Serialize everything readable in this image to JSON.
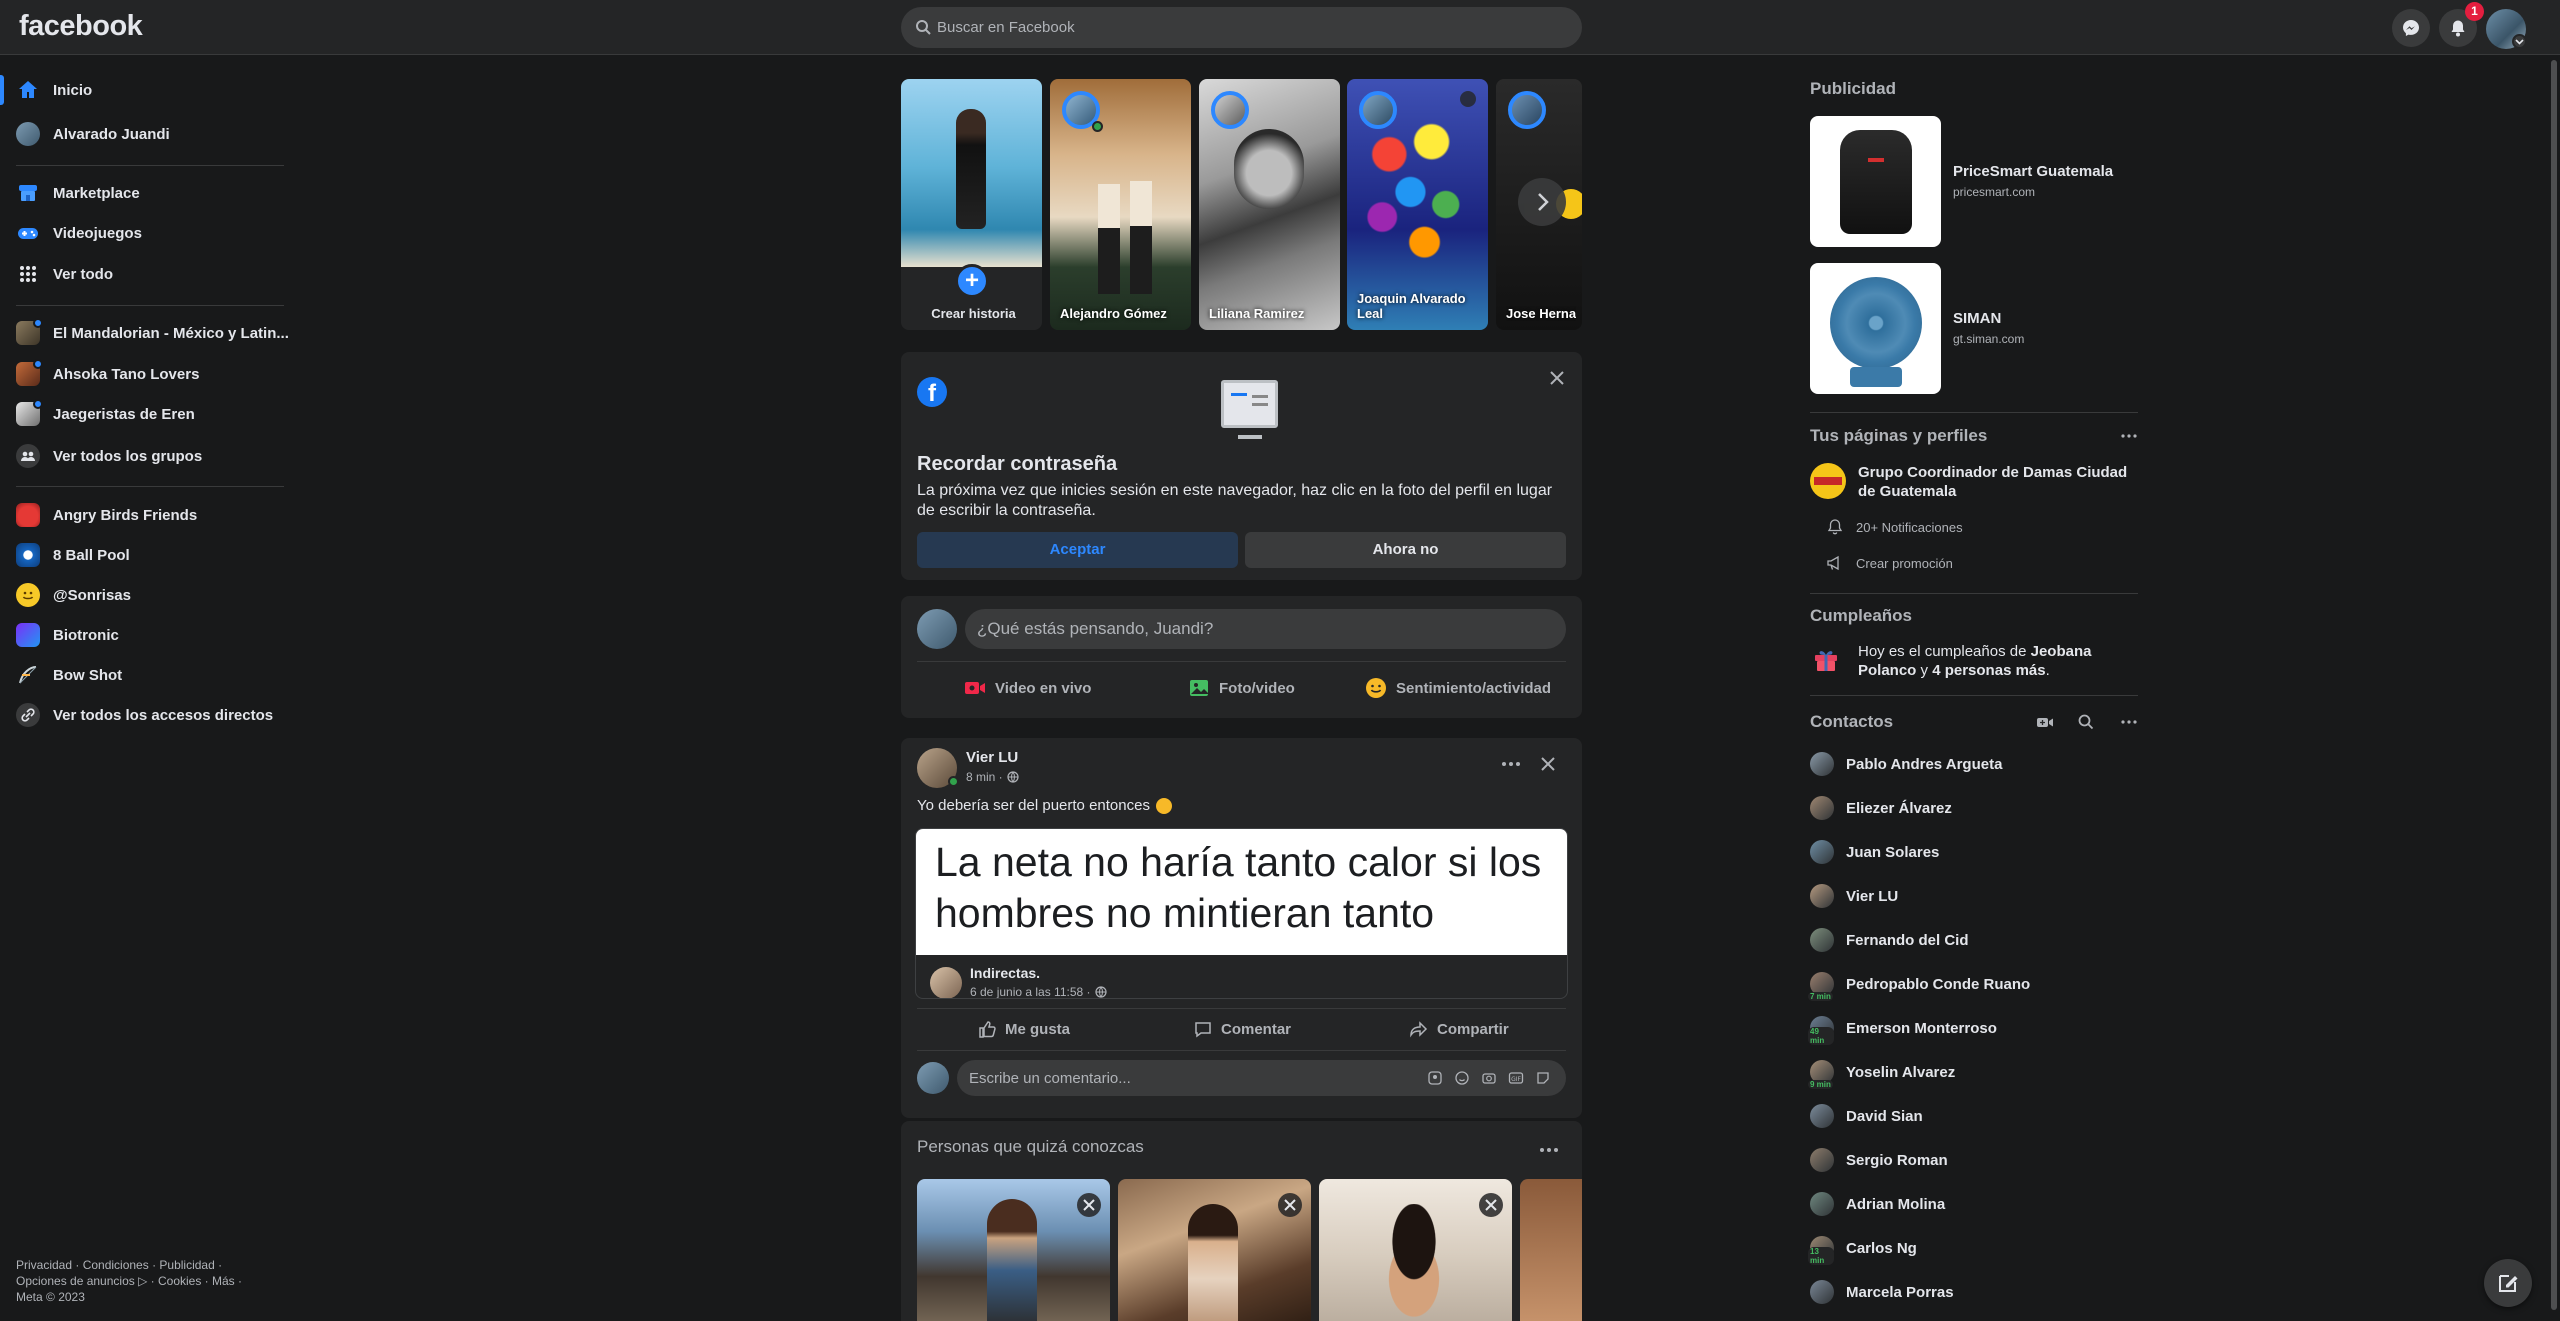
{
  "topbar": {
    "logo": "facebook",
    "search_placeholder": "Buscar en Facebook",
    "notification_count": "1"
  },
  "left_nav": {
    "main": [
      {
        "label": "Inicio",
        "icon": "home-icon"
      },
      {
        "label": "Alvarado Juandi",
        "icon": "avatar"
      },
      {
        "label": "Marketplace",
        "icon": "marketplace-icon"
      },
      {
        "label": "Videojuegos",
        "icon": "gamepad-icon"
      },
      {
        "label": "Ver todo",
        "icon": "grid-icon"
      }
    ],
    "groups": [
      {
        "label": "El Mandalorian - México y Latin..."
      },
      {
        "label": "Ahsoka Tano Lovers"
      },
      {
        "label": "Jaegeristas de Eren"
      },
      {
        "label": "Ver todos los grupos"
      }
    ],
    "shortcuts": [
      {
        "label": "Angry Birds Friends"
      },
      {
        "label": "8 Ball Pool"
      },
      {
        "label": "@Sonrisas"
      },
      {
        "label": "Biotronic"
      },
      {
        "label": "Bow Shot"
      },
      {
        "label": "Ver todos los accesos directos"
      }
    ],
    "footer_line1": "Privacidad · Condiciones · Publicidad ·",
    "footer_line2": "Opciones de anuncios ▷ · Cookies · Más ·",
    "footer_line3": "Meta © 2023"
  },
  "stories": [
    {
      "name": "Crear historia"
    },
    {
      "name": "Alejandro Gómez"
    },
    {
      "name": "Liliana Ramirez"
    },
    {
      "name": "Joaquin Alvarado Leal"
    },
    {
      "name": "Jose Hernandez"
    }
  ],
  "password_prompt": {
    "title": "Recordar contraseña",
    "body": "La próxima vez que inicies sesión en este navegador, haz clic en la foto del perfil en lugar de escribir la contraseña.",
    "accept": "Aceptar",
    "decline": "Ahora no"
  },
  "composer": {
    "placeholder": "¿Qué estás pensando, Juandi?",
    "live": "Video en vivo",
    "photo": "Foto/video",
    "feeling": "Sentimiento/actividad"
  },
  "post": {
    "author": "Vier LU",
    "time": "8 min ·",
    "text": "Yo debería ser del puerto entonces",
    "shared_text": "La neta no haría tanto calor si los hombres  no mintieran tanto",
    "shared_author": "Indirectas.",
    "shared_time": "6 de junio a las 11:58 ·",
    "like": "Me gusta",
    "comment": "Comentar",
    "share": "Compartir",
    "comment_placeholder": "Escribe un comentario..."
  },
  "pymk": {
    "title": "Personas que quizá conozcas"
  },
  "right": {
    "ads_title": "Publicidad",
    "ads": [
      {
        "name": "PriceSmart Guatemala",
        "url": "pricesmart.com"
      },
      {
        "name": "SIMAN",
        "url": "gt.siman.com"
      }
    ],
    "pages_title": "Tus páginas y perfiles",
    "page_name": "Grupo Coordinador de Damas Ciudad de Guatemala",
    "page_notifs": "20+ Notificaciones",
    "page_promo": "Crear promoción",
    "birthdays_title": "Cumpleaños",
    "birthday_pre": "Hoy es el cumpleaños de ",
    "birthday_name": "Jeobana Polanco",
    "birthday_mid": " y ",
    "birthday_others": "4 personas más",
    "birthday_end": ".",
    "contacts_title": "Contactos",
    "contacts": [
      {
        "name": "Pablo Andres Argueta",
        "badge": ""
      },
      {
        "name": "Eliezer Álvarez",
        "badge": ""
      },
      {
        "name": "Juan Solares",
        "badge": ""
      },
      {
        "name": "Vier LU",
        "badge": ""
      },
      {
        "name": "Fernando del Cid",
        "badge": ""
      },
      {
        "name": "Pedropablo Conde Ruano",
        "badge": "7 min"
      },
      {
        "name": "Emerson Monterroso",
        "badge": "49 min"
      },
      {
        "name": "Yoselin Alvarez",
        "badge": "9 min"
      },
      {
        "name": "David Sian",
        "badge": ""
      },
      {
        "name": "Sergio Roman",
        "badge": ""
      },
      {
        "name": "Adrian Molina",
        "badge": ""
      },
      {
        "name": "Carlos Ng",
        "badge": "13 min"
      },
      {
        "name": "Marcela Porras",
        "badge": ""
      }
    ]
  },
  "colors": {
    "accent": "#2d88ff",
    "bg": "#18191a",
    "surface": "#242526",
    "badge": "#e41e3f"
  }
}
